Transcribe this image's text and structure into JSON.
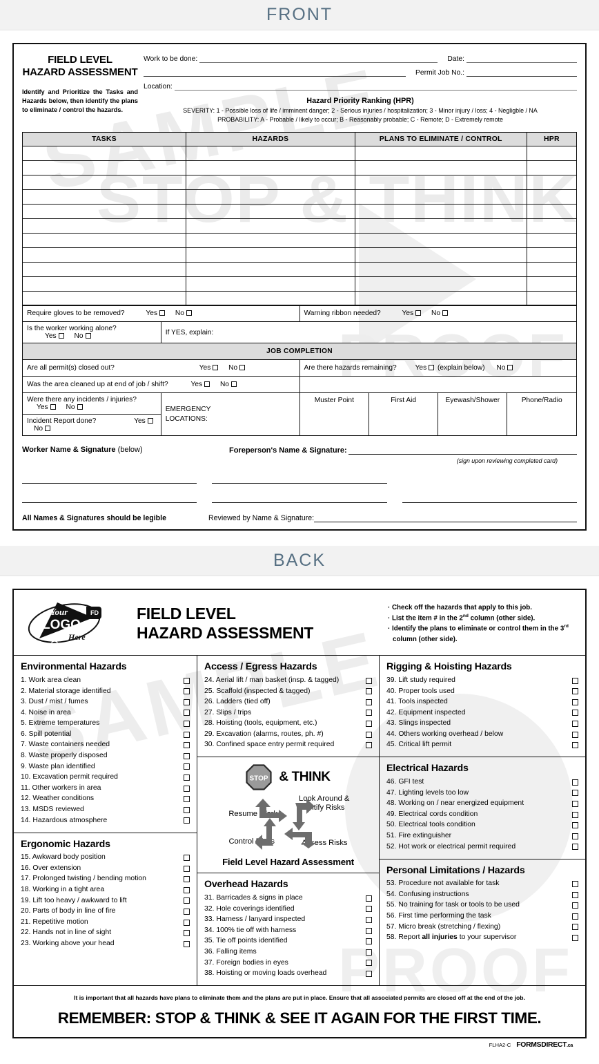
{
  "banners": {
    "front": "FRONT",
    "back": "BACK"
  },
  "front": {
    "title_line1": "FIELD LEVEL",
    "title_line2": "HAZARD ASSESSMENT",
    "instruction": "Identify and Prioritize the Tasks and Hazards below, then identify the plans to eliminate / control the hazards.",
    "fields": {
      "work_to_be_done": "Work to be done:",
      "date": "Date:",
      "permit_job_no": "Permit Job No.:",
      "location": "Location:"
    },
    "hpr": {
      "title": "Hazard Priority Ranking (HPR)",
      "severity": "SEVERITY: 1 - Possible loss of life / imminent danger; 2 - Serious injuries / hospitalization; 3 - Minor injury / loss; 4 - Negligble / NA",
      "probability": "PROBABILITY: A - Probable / likely to occur; B - Reasonably probable; C - Remote; D - Extremely remote"
    },
    "table": {
      "headers": [
        "TASKS",
        "HAZARDS",
        "PLANS TO ELIMINATE / CONTROL",
        "HPR"
      ],
      "row_count": 11
    },
    "questions": {
      "gloves": "Require gloves to be removed?",
      "warning_ribbon": "Warning ribbon needed?",
      "working_alone": "Is the worker working alone?",
      "if_yes_explain": "If YES, explain:",
      "job_completion": "JOB COMPLETION",
      "permits_closed": "Are all permit(s) closed out?",
      "hazards_remaining": "Are there hazards remaining?",
      "hazards_remaining_yes_note": "(explain below)",
      "area_cleaned": "Was the area cleaned up at end of job / shift?",
      "incidents": "Were there any incidents / injuries?",
      "incident_report": "Incident Report done?",
      "emergency_locations_l1": "EMERGENCY",
      "emergency_locations_l2": "LOCATIONS:",
      "yes": "Yes",
      "no": "No",
      "emergency_cols": [
        "Muster Point",
        "First Aid",
        "Eyewash/Shower",
        "Phone/Radio"
      ]
    },
    "signatures": {
      "worker_bold": "Worker Name & Signature",
      "worker_light": "(below)",
      "foreperson": "Foreperson's Name & Signature:",
      "note": "(sign upon reviewing completed card)",
      "legible": "All Names & Signatures should be legible",
      "reviewed_by": "Reviewed by Name & Signature:"
    }
  },
  "back": {
    "logo": {
      "top": "Your",
      "main": "LOGO",
      "bottom": "Here",
      "badge": "FD"
    },
    "title_line1": "FIELD LEVEL",
    "title_line2": "HAZARD ASSESSMENT",
    "instructions": [
      "Check off the hazards that apply to this job.",
      "List the item # in the 2nd column (other side).",
      "Identify the plans to eliminate or control them in the 3rd column (other side)."
    ],
    "sections": [
      {
        "heading": "Environmental Hazards",
        "items": [
          "1. Work area clean",
          "2. Material storage identified",
          "3. Dust / mist / fumes",
          "4. Noise in area",
          "5. Extreme temperatures",
          "6. Spill potential",
          "7. Waste containers needed",
          "8. Waste properly disposed",
          "9. Waste plan identified",
          "10. Excavation permit required",
          "11. Other workers in area",
          "12. Weather conditions",
          "13. MSDS reviewed",
          "14. Hazardous atmosphere"
        ]
      },
      {
        "heading": "Ergonomic Hazards",
        "items": [
          "15. Awkward body position",
          "16. Over extension",
          "17. Prolonged twisting / bending motion",
          "18. Working in a tight area",
          "19. Lift too heavy / awkward to lift",
          "20. Parts of body in line of fire",
          "21. Repetitive motion",
          "22. Hands not in line of sight",
          "23. Working above your head"
        ]
      },
      {
        "heading": "Access / Egress Hazards",
        "items": [
          "24. Aerial lift / man basket (insp. & tagged)",
          "25. Scaffold (inspected & tagged)",
          "26. Ladders (tied off)",
          "27. Slips / trips",
          "28. Hoisting (tools, equipment, etc.)",
          "29. Excavation (alarms, routes, ph. #)",
          "30. Confined space entry permit required"
        ]
      },
      {
        "heading": "Overhead Hazards",
        "items": [
          "31. Barricades & signs in place",
          "32. Hole coverings identified",
          "33. Harness / lanyard inspected",
          "34. 100% tie off with harness",
          "35. Tie off points identified",
          "36. Falling items",
          "37. Foreign bodies in eyes",
          "38. Hoisting or moving loads overhead"
        ]
      },
      {
        "heading": "Rigging & Hoisting Hazards",
        "items": [
          "39. Lift study required",
          "40. Proper tools used",
          "41. Tools inspected",
          "42. Equipment inspected",
          "43. Slings inspected",
          "44. Others working overhead / below",
          "45. Critical lift permit"
        ]
      },
      {
        "heading": "Electrical Hazards",
        "items": [
          "46. GFI test",
          "47. Lighting levels too low",
          "48. Working on / near energized equipment",
          "49. Electrical cords condition",
          "50. Electrical tools condition",
          "51. Fire extinguisher",
          "52. Hot work or electrical permit required"
        ]
      },
      {
        "heading": "Personal Limitations / Hazards",
        "items": [
          "53. Procedure not available for task",
          "54. Confusing instructions",
          "55. No training for task or tools to be used",
          "56. First time performing the task",
          "57. Micro break (stretching / flexing)",
          "58. Report all injuries to your supervisor"
        ]
      }
    ],
    "stop_think": {
      "stop": "STOP",
      "and_think": "& THINK",
      "look_around": "Look Around & Identify Risks",
      "assess": "Assess Risks",
      "control": "Control Risks",
      "resume": "Resume Work",
      "caption": "Field Level Hazard Assessment"
    },
    "footer": {
      "note": "It is important that all hazards have plans to eliminate them and the plans are put in place. Ensure that all associated permits are closed off at the end of the job.",
      "remember": "REMEMBER: STOP & THINK & SEE IT AGAIN FOR THE FIRST TIME.",
      "code": "FLHA2-C",
      "brand": "FORMSDIRECT",
      "brand_tld": ".ca"
    }
  },
  "watermarks": {
    "sample": "SAMPLE",
    "proof": "PROOF",
    "stop": "STOP",
    "think": "& THINK"
  },
  "colors": {
    "banner_text": "#577083",
    "banner_bg": "#f2f2f2",
    "header_fill": "#dcdcdc",
    "ink": "#111111"
  }
}
